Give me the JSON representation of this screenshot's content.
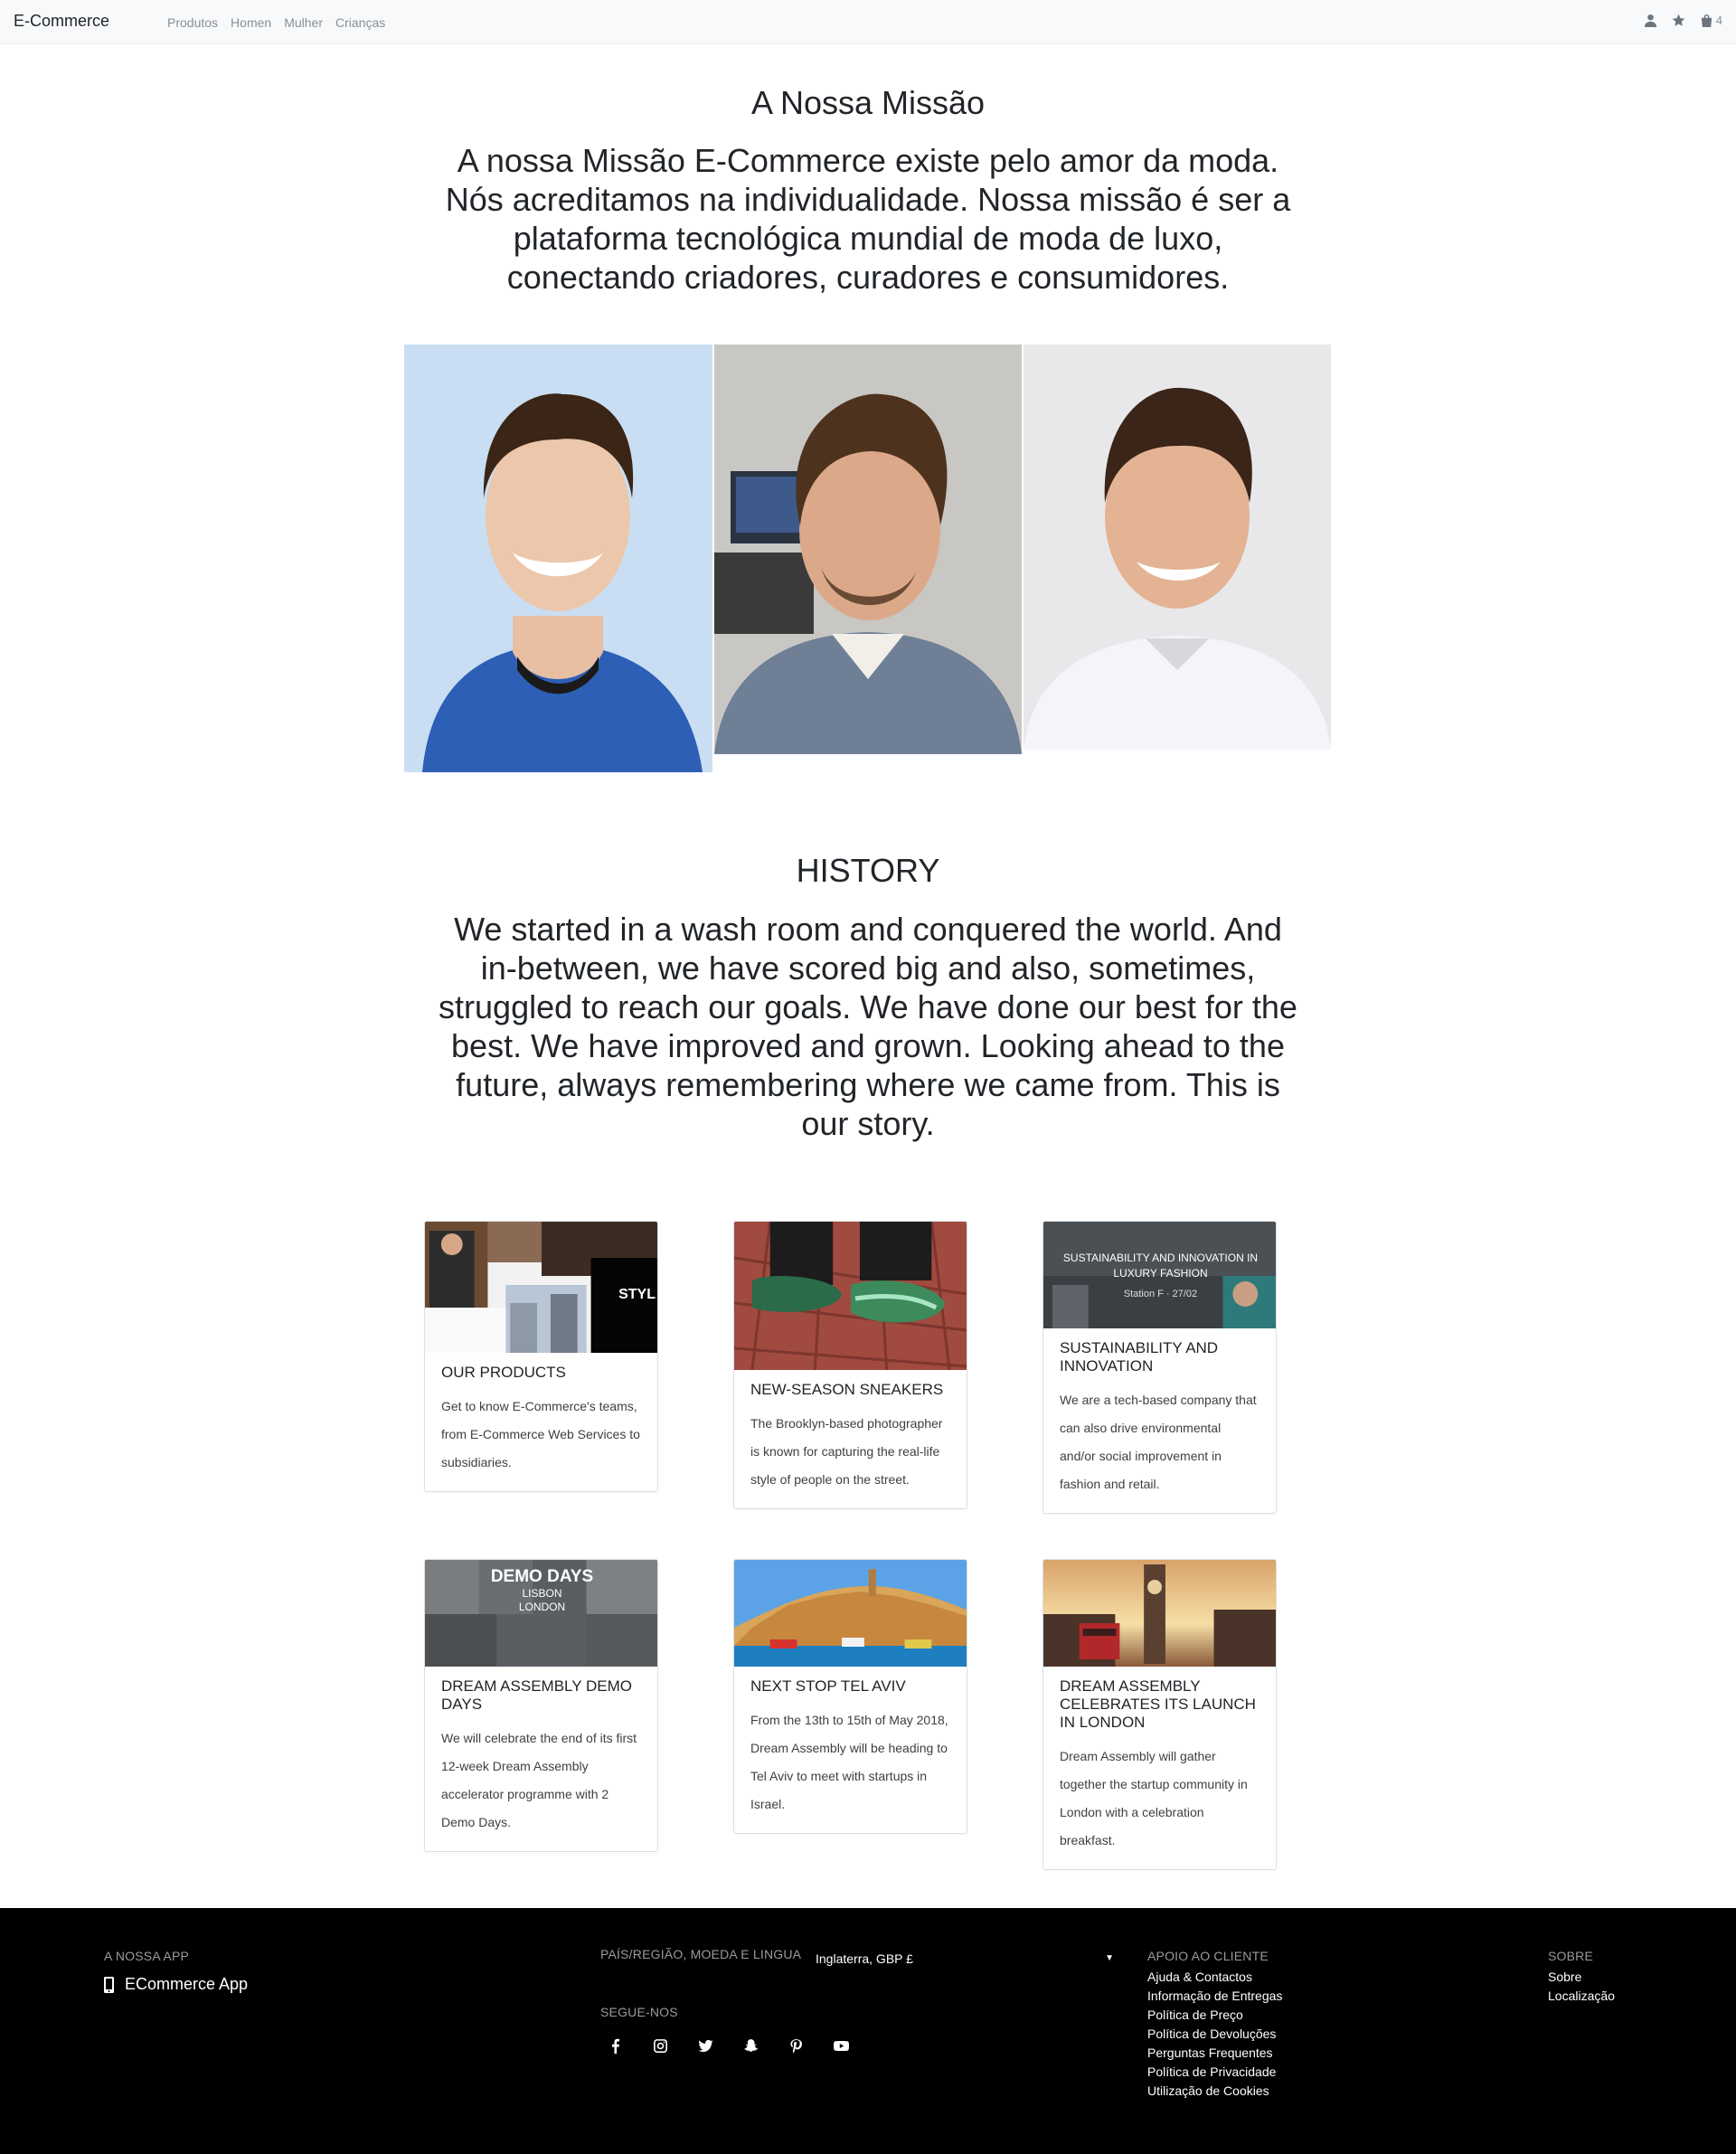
{
  "navbar": {
    "brand": "E-Commerce",
    "links": [
      "Produtos",
      "Homen",
      "Mulher",
      "Crianças"
    ],
    "cart_count": "4"
  },
  "mission": {
    "title": "A Nossa Missão",
    "text": "A nossa Missão E-Commerce existe pelo amor da moda. Nós acreditamos na individualidade. Nossa missão é ser a plataforma tecnológica mundial de moda de luxo, conectando criadores, curadores e consumidores."
  },
  "history": {
    "title": "HISTORY",
    "text": "We started in a wash room and conquered the world. And in-between, we have scored big and also, sometimes, struggled to reach our goals. We have done our best for the best. We have improved and grown. Looking ahead to the future, always remembering where we came from. This is our story."
  },
  "cards": [
    {
      "title": "OUR PRODUCTS",
      "text": "Get to know E-Commerce's teams, from E-Commerce Web Services to subsidiaries.",
      "img_text": "STYL"
    },
    {
      "title": "NEW-SEASON SNEAKERS",
      "text": "The Brooklyn-based photographer is known for capturing the real-life style of people on the street."
    },
    {
      "title": "SUSTAINABILITY AND INNOVATION",
      "text": "We are a tech-based company that can also drive environmental and/or social improvement in fashion and retail.",
      "img_text": "SUSTAINABILITY AND INNOVATION IN LUXURY FASHION",
      "img_sub": "Station F · 27/02"
    },
    {
      "title": "DREAM ASSEMBLY DEMO DAYS",
      "text": "We will celebrate the end of its first 12-week Dream Assembly accelerator programme with 2 Demo Days.",
      "img_text": "DEMO DAYS",
      "img_sub": "LISBON",
      "img_sub2": "LONDON"
    },
    {
      "title": "NEXT STOP TEL AVIV",
      "text": "From the 13th to 15th of May 2018, Dream Assembly will be heading to Tel Aviv to meet with startups in Israel."
    },
    {
      "title": "DREAM ASSEMBLY CELEBRATES ITS LAUNCH IN LONDON",
      "text": "Dream Assembly will gather together the startup community in London with a celebration breakfast."
    }
  ],
  "footer": {
    "app_heading": "A NOSSA APP",
    "app_label": "ECommerce App",
    "region_heading": "PAÍS/REGIÃO, MOEDA E LINGUA",
    "region_value": "Inglaterra, GBP £",
    "social_heading": "SEGUE-NOS",
    "support_heading": "APOIO AO CLIENTE",
    "support_links": [
      "Ajuda & Contactos",
      "Informação de Entregas",
      "Política de Preço",
      "Política de Devoluções",
      "Perguntas Frequentes",
      "Política de Privacidade",
      "Utilização de Cookies"
    ],
    "about_heading": "SOBRE",
    "about_links": [
      "Sobre",
      "Localização"
    ]
  }
}
